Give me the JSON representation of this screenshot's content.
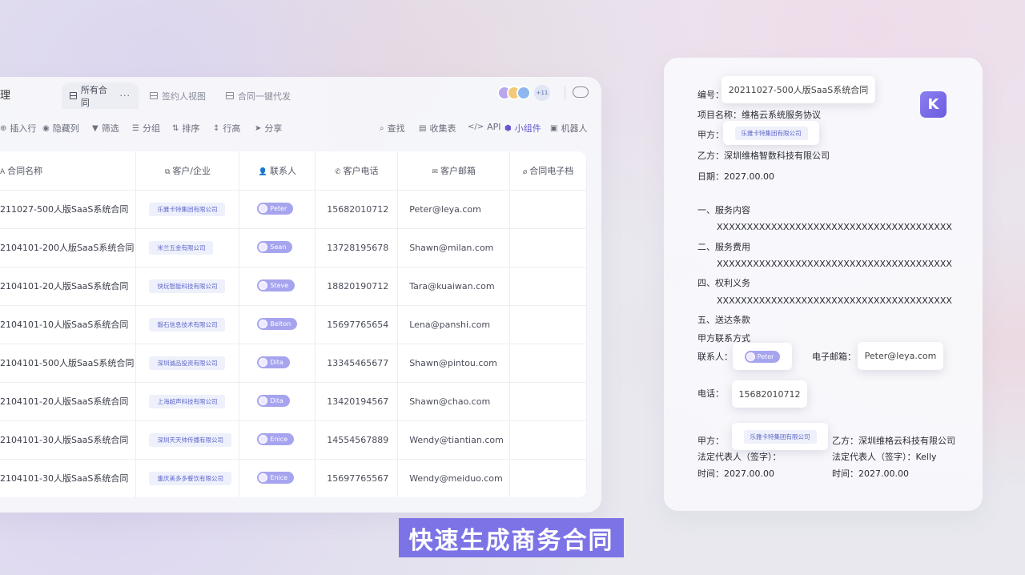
{
  "app": {
    "title_stub": "理",
    "tabs": [
      {
        "label": "所有合同",
        "more": "···"
      },
      {
        "label": "签约人视图"
      },
      {
        "label": "合同一键代发"
      }
    ],
    "collaborator_count": "+11",
    "toolbar": {
      "insert_row": "插入行",
      "hide_column": "隐藏列",
      "filter": "筛选",
      "group": "分组",
      "sort": "排序",
      "row_height": "行高",
      "share": "分享",
      "search": "查找",
      "form": "收集表",
      "api": "API",
      "widget": "小组件",
      "robot": "机器人"
    },
    "columns": [
      "合同名称",
      "客户/企业",
      "联系人",
      "客户电话",
      "客户邮箱",
      "合同电子档"
    ],
    "rows": [
      {
        "name": "211027-500人版SaaS系统合同",
        "company": "乐雅卡特集团有限公司",
        "contact": "Peter",
        "phone": "15682010712",
        "email": "Peter@leya.com"
      },
      {
        "name": "2104101-200人版SaaS系统合同",
        "company": "米兰五金有限公司",
        "contact": "Sean",
        "phone": "13728195678",
        "email": "Shawn@milan.com"
      },
      {
        "name": "2104101-20人版SaaS系统合同",
        "company": "快玩智能科技有限公司",
        "contact": "Steve",
        "phone": "18820190712",
        "email": "Tara@kuaiwan.com"
      },
      {
        "name": "2104101-10人版SaaS系统合同",
        "company": "磐石信息技术有限公司",
        "contact": "Belton",
        "phone": "15697765654",
        "email": "Lena@panshi.com"
      },
      {
        "name": "2104101-500人版SaaS系统合同",
        "company": "深圳诚品投资有限公司",
        "contact": "Dita",
        "phone": "13345465677",
        "email": "Shawn@pintou.com"
      },
      {
        "name": "2104101-20人版SaaS系统合同",
        "company": "上海超声科技有限公司",
        "contact": "Dita",
        "phone": "13420194567",
        "email": "Shawn@chao.com"
      },
      {
        "name": "2104101-30人版SaaS系统合同",
        "company": "深圳天天帅传播有限公司",
        "contact": "Enice",
        "phone": "14554567889",
        "email": "Wendy@tiantian.com"
      },
      {
        "name": "2104101-30人版SaaS系统合同",
        "company": "重庆美多多餐饮有限公司",
        "contact": "Enice",
        "phone": "15697765567",
        "email": "Wendy@meiduo.com"
      }
    ]
  },
  "contract": {
    "number_label": "编号：",
    "number_value": "20211027-500人版SaaS系统合同",
    "project": "项目名称：维格云系统服务协议",
    "party_a_label": "甲方：",
    "party_a_value": "乐雅卡特集团有限公司",
    "party_b": "乙方：深圳维格智数科技有限公司",
    "date": "日期：2027.00.00",
    "s1": "一、服务内容",
    "x1": "XXXXXXXXXXXXXXXXXXXXXXXXXXXXXXXXXXXXXXX",
    "s2": "二、服务费用",
    "x2": "XXXXXXXXXXXXXXXXXXXXXXXXXXXXXXXXXXXXXXX",
    "s4": "四、权利义务",
    "x4": "XXXXXXXXXXXXXXXXXXXXXXXXXXXXXXXXXXXXXXX",
    "s5": "五、送达条款",
    "contact_way": "甲方联系方式",
    "contact_label": "联系人：",
    "contact_value": "Peter",
    "email_label": "电子邮箱：",
    "email_value": "Peter@leya.com",
    "phone_label": "电话：",
    "phone_value": "15682010712",
    "sign_a_label": "甲方：",
    "sign_a_value": "乐雅卡特集团有限公司",
    "sign_a_rep": "法定代表人（签字）：",
    "sign_a_time": "时间：2027.00.00",
    "sign_b_label": "乙方：深圳维格云科技有限公司",
    "sign_b_rep": "法定代表人（签字）：Kelly",
    "sign_b_time": "时间：2027.00.00",
    "logo_char": "K"
  },
  "caption": "快速生成商务合同",
  "colors": {
    "accent": "#7c73e6",
    "chip_text": "#5e67c9",
    "pill": "#a6a4ee"
  }
}
